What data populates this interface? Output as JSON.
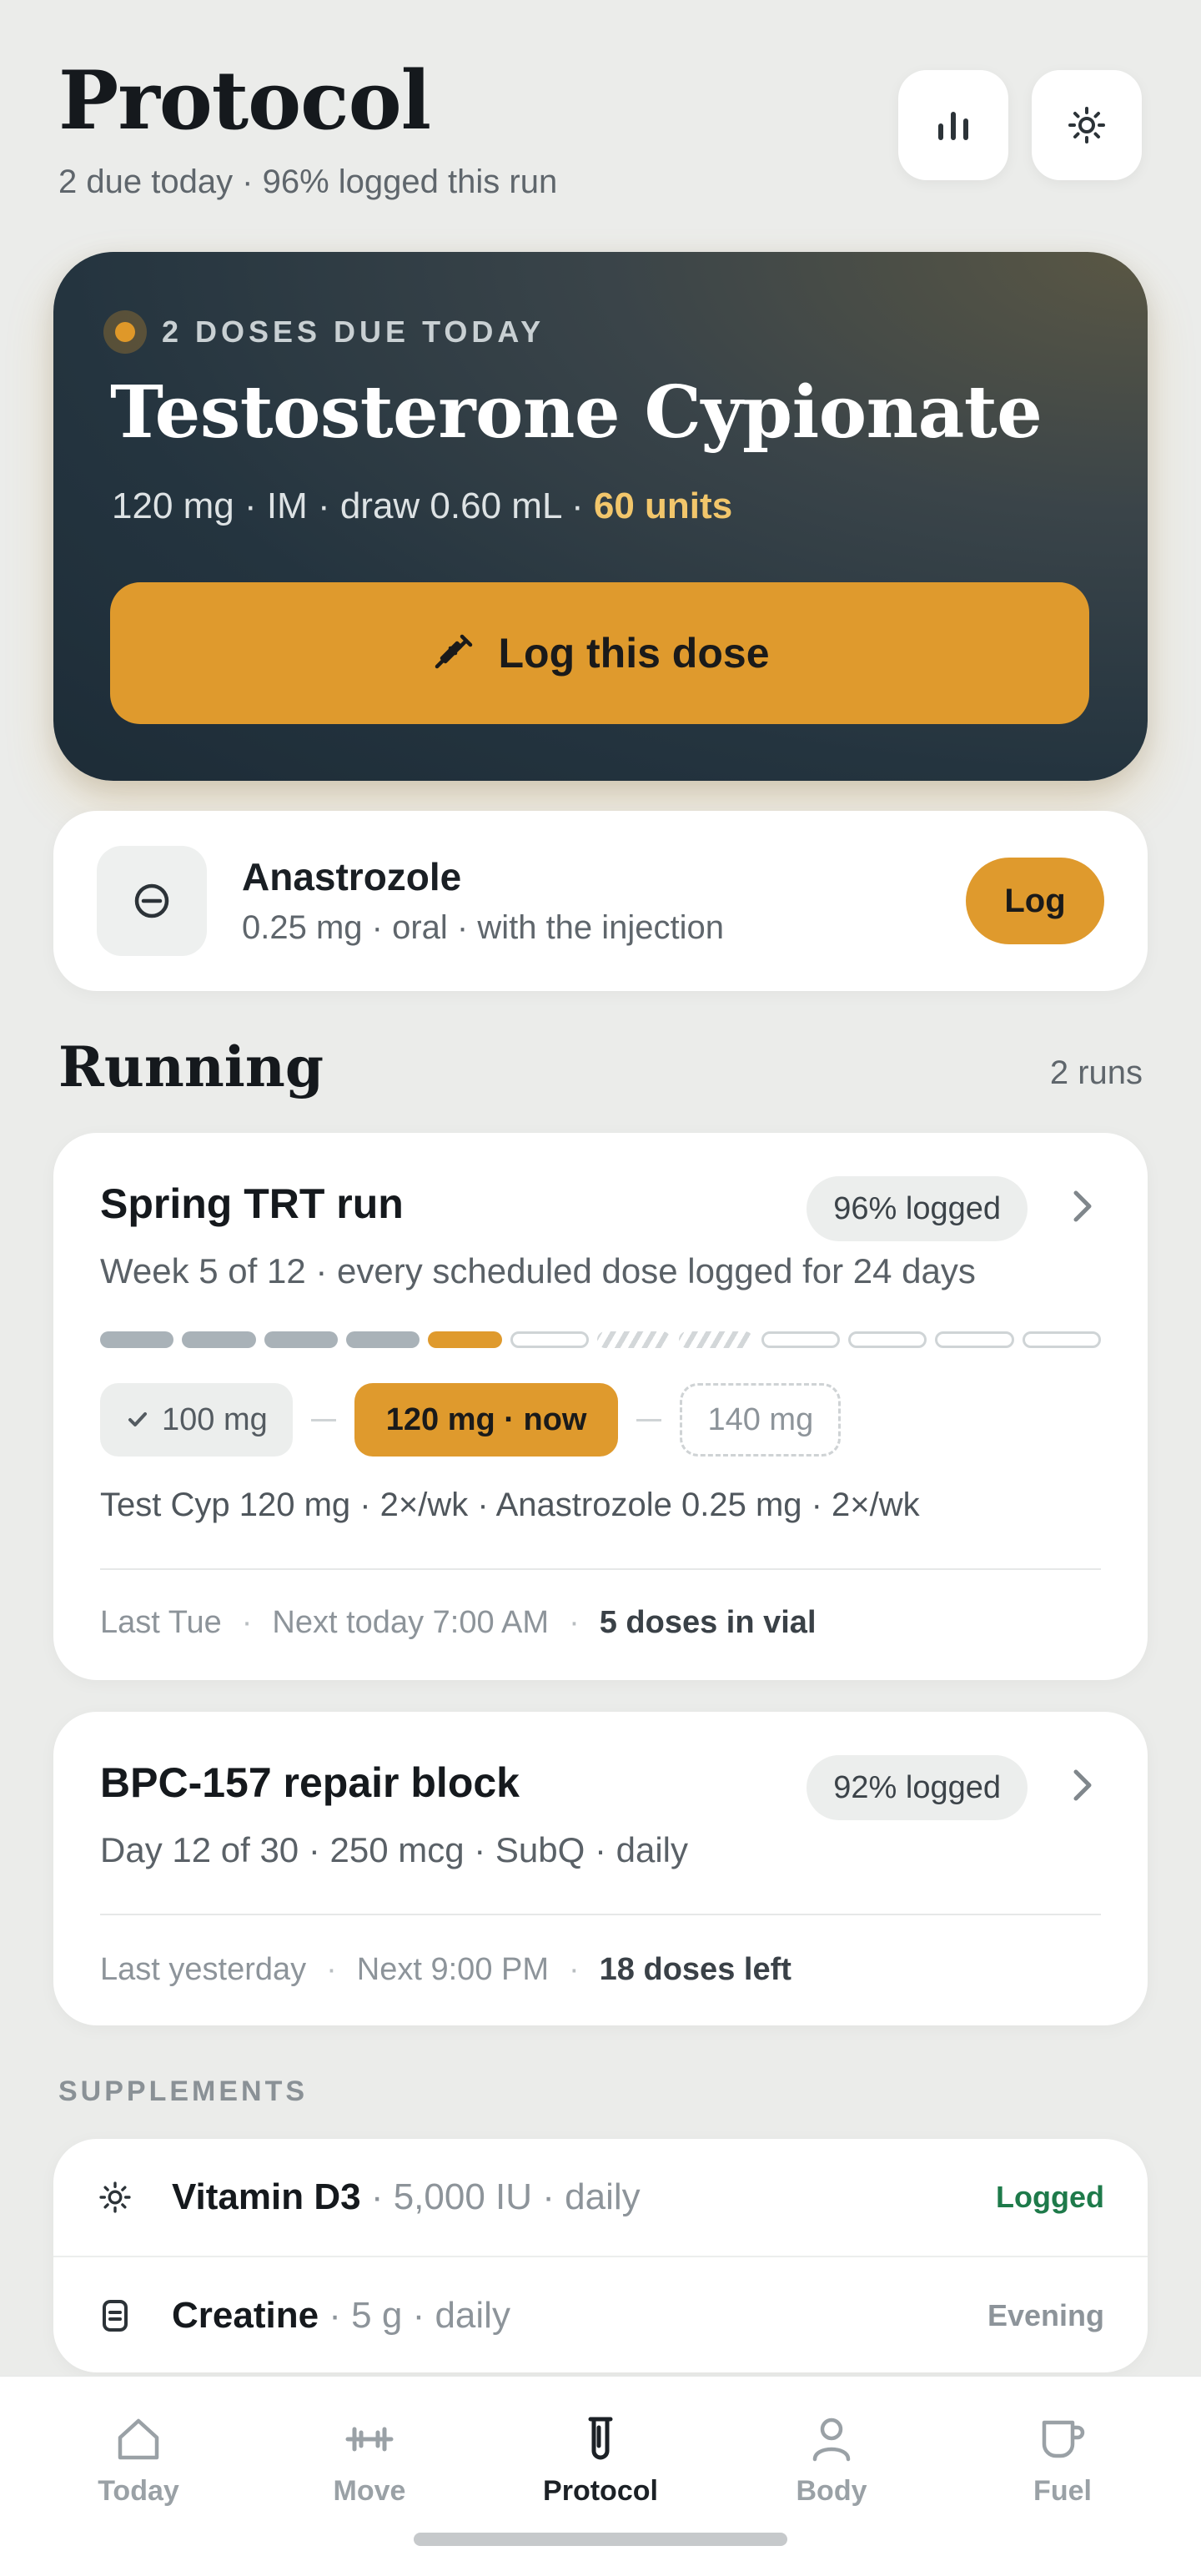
{
  "header": {
    "title": "Protocol",
    "subtitle": "2 due today · 96% logged this run",
    "stats_icon": "bar-chart-icon",
    "theme_icon": "sun-icon"
  },
  "hero": {
    "tag": "2 DOSES DUE TODAY",
    "drug": "Testosterone Cypionate",
    "detail": "120 mg · IM · draw 0.60 mL · ",
    "units": "60 units",
    "log_button": "Log this dose",
    "accent": "#df9a2d"
  },
  "secondary_dose": {
    "name": "Anastrozole",
    "detail": "0.25 mg · oral · with the injection",
    "log_button": "Log"
  },
  "running": {
    "title": "Running",
    "count": "2 runs",
    "runs": [
      {
        "title": "Spring TRT run",
        "logged": "96% logged",
        "subtitle": "Week 5 of 12 · every scheduled dose logged for 24 days",
        "weeks": [
          "done",
          "done",
          "done",
          "done",
          "current",
          "empty",
          "skip",
          "skip",
          "empty",
          "empty",
          "empty",
          "empty"
        ],
        "chips": {
          "prev": "100 mg",
          "now": "120 mg · now",
          "next": "140 mg"
        },
        "stack": "Test Cyp 120 mg · 2×/wk · Anastrozole 0.25 mg · 2×/wk",
        "last": "Last Tue",
        "next": "Next today 7:00 AM",
        "remaining": "5 doses in vial"
      },
      {
        "title": "BPC-157 repair block",
        "logged": "92% logged",
        "subtitle": "Day 12 of 30 · 250 mcg · SubQ · daily",
        "last": "Last yesterday",
        "next": "Next 9:00 PM",
        "remaining": "18 doses left"
      }
    ]
  },
  "supplements": {
    "label": "SUPPLEMENTS",
    "items": [
      {
        "name": "Vitamin D3",
        "detail": " · 5,000 IU · daily",
        "status": "Logged",
        "status_color": "#1e7a4a",
        "icon": "sun-icon"
      },
      {
        "name": "Creatine",
        "detail": " · 5 g · daily",
        "status": "Evening",
        "status_color": "#8d949a",
        "icon": "capsule-icon"
      }
    ]
  },
  "tabbar": {
    "tabs": [
      {
        "label": "Today",
        "icon": "home-icon"
      },
      {
        "label": "Move",
        "icon": "dumbbell-icon"
      },
      {
        "label": "Protocol",
        "icon": "vial-icon",
        "active": true
      },
      {
        "label": "Body",
        "icon": "person-icon"
      },
      {
        "label": "Fuel",
        "icon": "cup-icon"
      }
    ]
  }
}
